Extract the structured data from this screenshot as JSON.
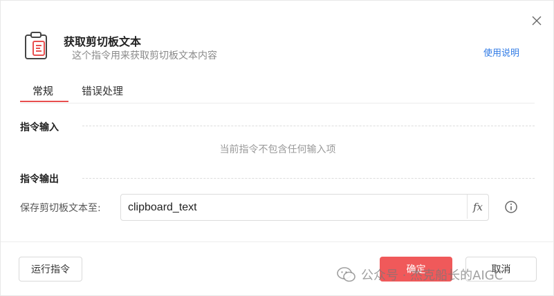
{
  "dialog": {
    "title": "获取剪切板文本",
    "subtitle": "这个指令用来获取剪切板文本内容",
    "help_link": "使用说明"
  },
  "tabs": [
    {
      "label": "常规",
      "active": true
    },
    {
      "label": "错误处理",
      "active": false
    }
  ],
  "input_section": {
    "title": "指令输入",
    "empty_note": "当前指令不包含任何输入项"
  },
  "output_section": {
    "title": "指令输出",
    "field_label": "保存剪切板文本至:",
    "field_value": "clipboard_text",
    "fx_label": "fx"
  },
  "footer": {
    "run_label": "运行指令",
    "ok_label": "确定",
    "cancel_label": "取消"
  },
  "watermark": "公众号 · 杰克船长的AIGC",
  "colors": {
    "accent": "#f0595a",
    "link": "#2f7ae5"
  }
}
